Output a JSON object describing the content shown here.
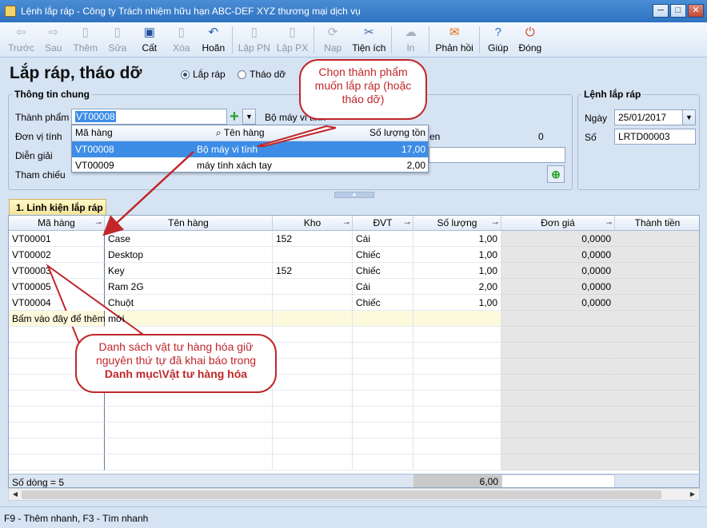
{
  "window": {
    "title": "Lệnh lắp ráp - Công ty Trách nhiệm hữu hạn ABC-DEF XYZ thương mại dịch vụ",
    "min": "─",
    "max": "□",
    "close": "✕"
  },
  "toolbar": {
    "back": "Trước",
    "next": "Sau",
    "add": "Thêm",
    "edit": "Sửa",
    "save": "Cất",
    "delete": "Xóa",
    "undo": "Hoãn",
    "make_pn": "Lập PN",
    "make_px": "Lập PX",
    "load": "Nạp",
    "utilities": "Tiện ích",
    "print": "In",
    "feedback": "Phản hồi",
    "help": "Giúp",
    "close": "Đóng"
  },
  "page": {
    "title": "Lắp ráp, tháo dỡ",
    "radio_assemble": "Lắp ráp",
    "radio_disassemble": "Tháo dỡ"
  },
  "general": {
    "group_title": "Thông tin chung",
    "product_label": "Thành phẩm",
    "product_value": "VT00008",
    "product_name": "Bộ máy vi tính",
    "unit_label": "Đơn vị tính",
    "qty_fragment": "en",
    "qty_value": "0",
    "desc_label": "Diễn giải",
    "ref_label": "Tham chiếu"
  },
  "dropdown": {
    "headers": [
      "Mã hàng",
      "Tên hàng",
      "Số lượng tồn"
    ],
    "rows": [
      {
        "code": "VT00008",
        "name": "Bộ máy vi tính",
        "stock": "17,00"
      },
      {
        "code": "VT00009",
        "name": "máy tính xách tay",
        "stock": "2,00"
      }
    ]
  },
  "order": {
    "group_title": "Lệnh lắp ráp",
    "date_label": "Ngày",
    "date_value": "25/01/2017",
    "no_label": "Số",
    "no_value": "LRTD00003"
  },
  "tab": {
    "label": "1. Linh kiện lắp ráp"
  },
  "grid": {
    "headers": [
      "Mã hàng",
      "Tên hàng",
      "Kho",
      "ĐVT",
      "Số lượng",
      "Đơn giá",
      "Thành tiền"
    ],
    "rows": [
      {
        "code": "VT00001",
        "name": "Case",
        "kho": "152",
        "unit": "Cái",
        "qty": "1,00",
        "price": "0,0000"
      },
      {
        "code": "VT00002",
        "name": "Desktop",
        "kho": "",
        "unit": "Chiếc",
        "qty": "1,00",
        "price": "0,0000"
      },
      {
        "code": "VT00003",
        "name": "Key",
        "kho": "152",
        "unit": "Chiếc",
        "qty": "1,00",
        "price": "0,0000"
      },
      {
        "code": "VT00005",
        "name": "Ram 2G",
        "kho": "",
        "unit": "Cái",
        "qty": "2,00",
        "price": "0,0000"
      },
      {
        "code": "VT00004",
        "name": "Chuột",
        "kho": "",
        "unit": "Chiếc",
        "qty": "1,00",
        "price": "0,0000"
      }
    ],
    "new_row_hint": "Bấm vào đây để thêm mới",
    "footer_count": "Số dòng = 5",
    "footer_qty_total": "6,00"
  },
  "status": {
    "text": "F9 - Thêm nhanh, F3 - Tìm nhanh"
  },
  "callouts": {
    "top_line1": "Chọn thành phẩm",
    "top_line2": "muốn lắp ráp (hoặc",
    "top_line3": "tháo dỡ)",
    "bottom_line1": "Danh sách vật tư hàng hóa giữ",
    "bottom_line2": "nguyên thứ tự đã khai báo trong",
    "bottom_line3": "Danh mục\\Vật tư hàng hóa"
  },
  "colors": {
    "accent": "#c0262a",
    "selection": "#3d8de6",
    "titlebar": "#2f72c0"
  }
}
